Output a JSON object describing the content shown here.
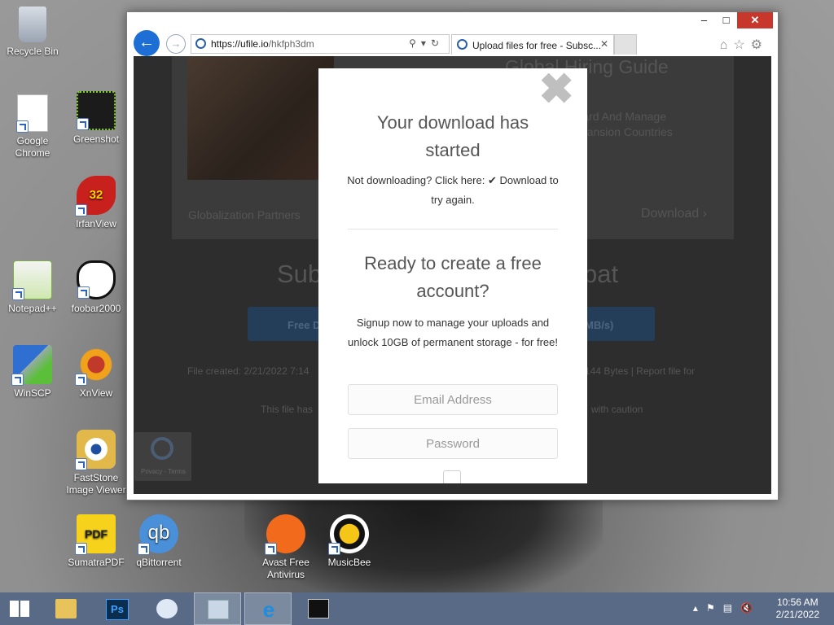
{
  "desktop": {
    "icons": [
      {
        "label": "Recycle Bin"
      },
      {
        "label": "Google Chrome"
      },
      {
        "label": "Greenshot"
      },
      {
        "label": "IrfanView"
      },
      {
        "label": "Notepad++"
      },
      {
        "label": "foobar2000"
      },
      {
        "label": "WinSCP"
      },
      {
        "label": "XnView"
      },
      {
        "label": "FastStone Image Viewer"
      },
      {
        "label": "SumatraPDF"
      },
      {
        "label": "qBittorrent"
      },
      {
        "label": "Avast Free Antivirus"
      },
      {
        "label": "MusicBee"
      }
    ]
  },
  "browser": {
    "address": {
      "host": "https://ufile.io",
      "path": "/hkfph3dm"
    },
    "tab_title": "Upload files for free - Subsc...",
    "window_controls": {
      "minimize": "–",
      "maximize": "□",
      "close": "✕"
    }
  },
  "page": {
    "ad": {
      "title": "Global Hiring Guide",
      "subtitle_line1": "Onboard And Manage",
      "subtitle_line2": "In Expansion Countries",
      "brand": "Globalization Partners",
      "download": "Download ›"
    },
    "background_heading_left": "Sub",
    "background_heading_right": "bat",
    "background_button_left": "Free D",
    "background_button_right": "MB/s)",
    "file_created": "File created: 2/21/2022 7:14",
    "file_bytes": "144 Bytes   |   Report file for",
    "warning_left": "This file has",
    "warning_right": "with caution",
    "recaptcha_text": "Privacy - Terms"
  },
  "modal": {
    "close": "✖",
    "heading": "Your download has started",
    "not_downloading": "Not downloading? Click here: ✔ Download to try again.",
    "heading2": "Ready to create a free account?",
    "signup_text": "Signup now to manage your uploads and unlock 10GB of permanent storage - for free!",
    "email_placeholder": "Email Address",
    "password_placeholder": "Password"
  },
  "taskbar": {
    "clock_time": "10:56 AM",
    "clock_date": "2/21/2022"
  }
}
